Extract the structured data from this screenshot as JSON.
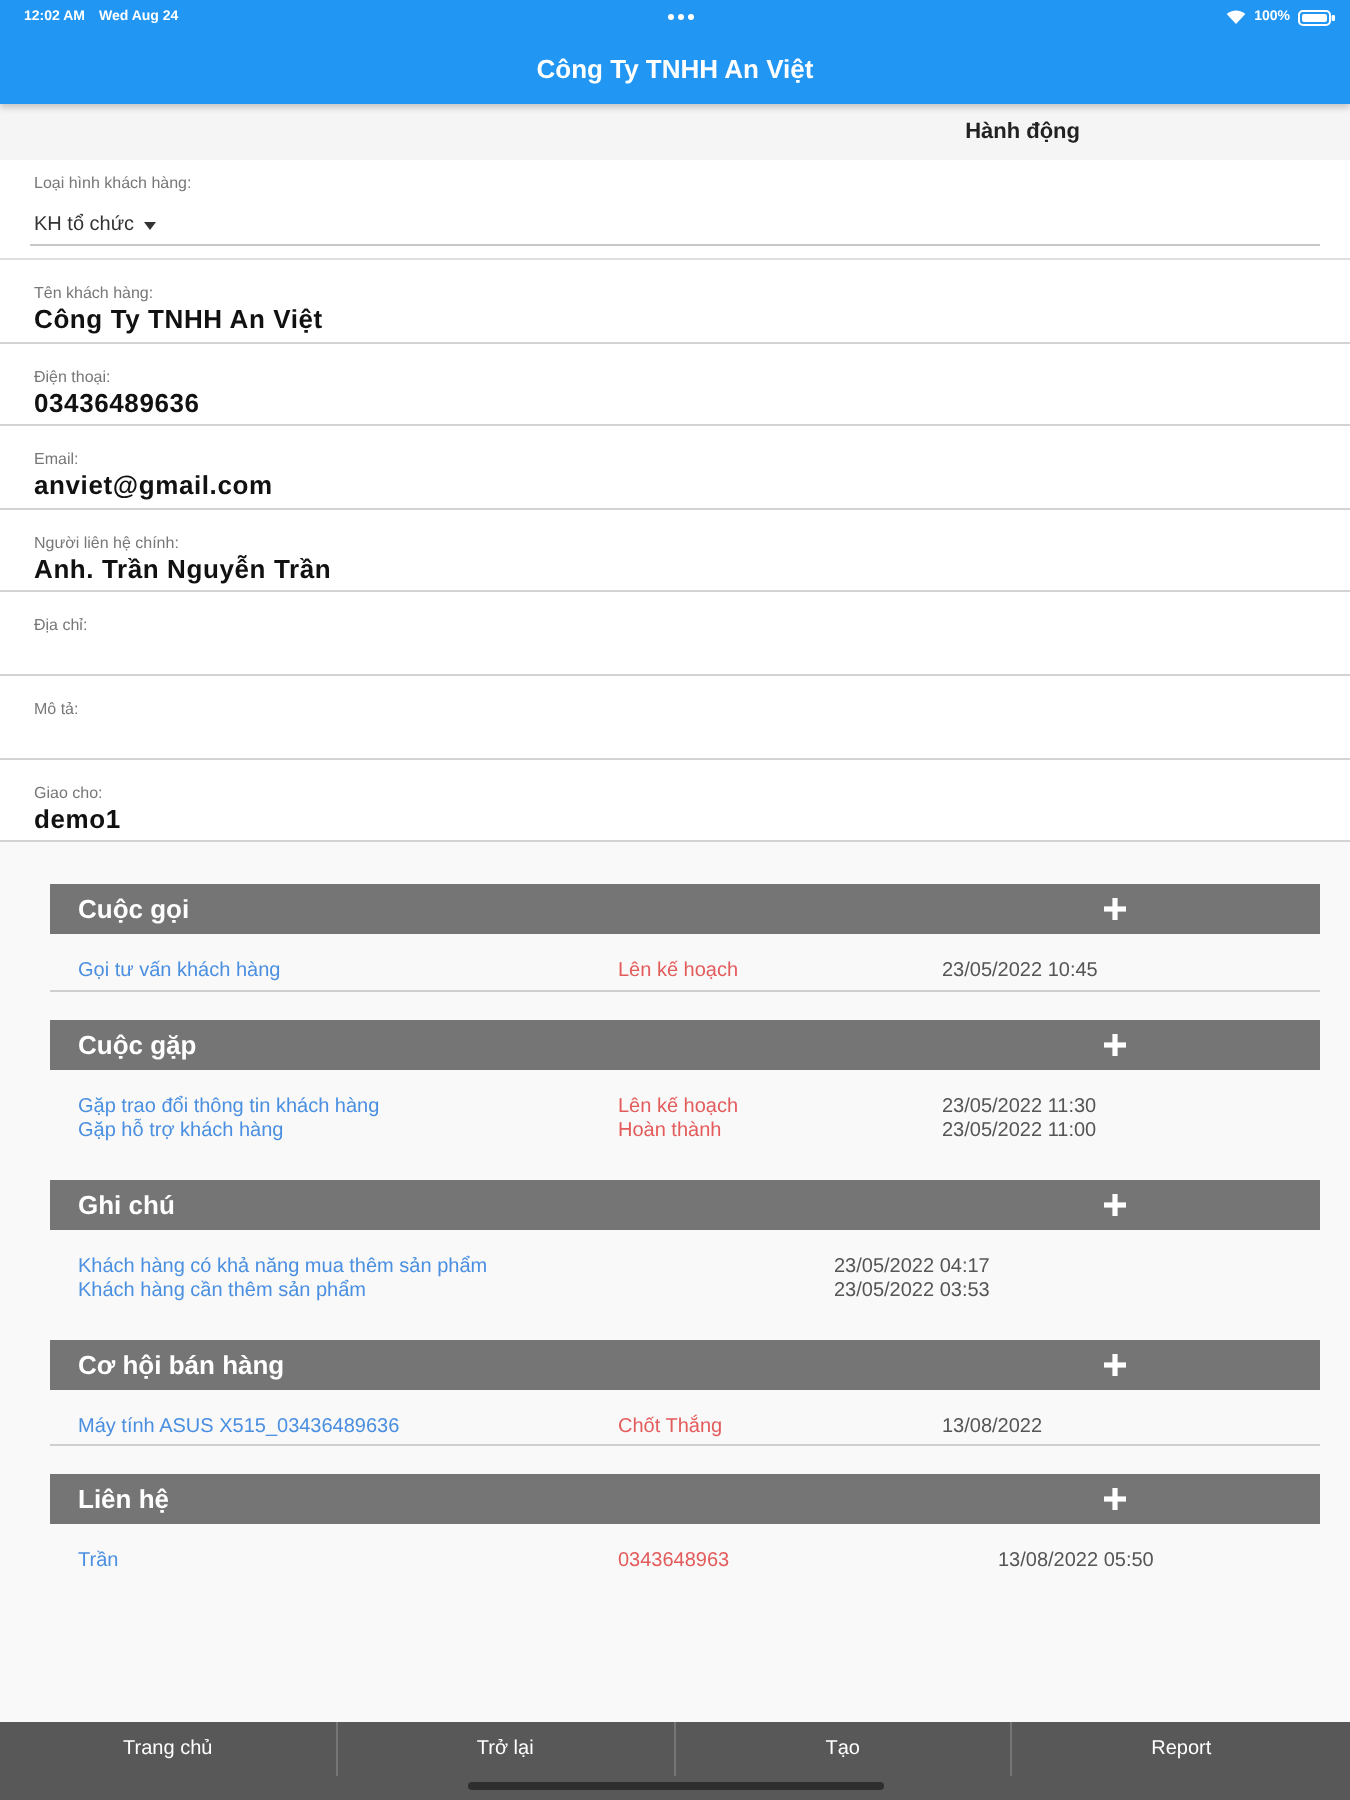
{
  "status_bar": {
    "time": "12:02 AM",
    "date": "Wed Aug 24",
    "battery": "100%"
  },
  "app_bar": {
    "title": "Công Ty TNHH An Việt"
  },
  "action_bar": {
    "label": "Hành động"
  },
  "form": {
    "fields": [
      {
        "kind": "dropdown",
        "label": "Loại hình khách hàng:",
        "value": "KH tổ chức"
      },
      {
        "kind": "text",
        "label": "Tên khách hàng:",
        "value": "Công Ty TNHH An Việt"
      },
      {
        "kind": "text",
        "label": "Điện thoại:",
        "value": "03436489636"
      },
      {
        "kind": "text",
        "label": "Email:",
        "value": "anviet@gmail.com"
      },
      {
        "kind": "text",
        "label": "Người liên hệ chính:",
        "value": "Anh. Trần Nguyễn Trần"
      },
      {
        "kind": "text",
        "label": "Địa chỉ:"
      },
      {
        "kind": "text",
        "label": "Mô tả:"
      },
      {
        "kind": "text",
        "label": "Giao cho:",
        "value": "demo1"
      }
    ]
  },
  "sections": [
    {
      "kind": "activity",
      "title": "Cuộc gọi",
      "underlined": true,
      "rows": [
        {
          "title": "Gọi tư vấn khách hàng",
          "status": "Lên kế hoạch",
          "date": "23/05/2022 10:45"
        }
      ]
    },
    {
      "kind": "activity",
      "title": "Cuộc gặp",
      "underlined": false,
      "rows": [
        {
          "title": "Gặp trao đổi thông tin khách hàng",
          "status": "Lên kế hoạch",
          "date": "23/05/2022 11:30"
        },
        {
          "title": "Gặp hỗ trợ khách hàng",
          "status": "Hoàn thành",
          "date": "23/05/2022 11:00"
        }
      ]
    },
    {
      "kind": "note",
      "title": "Ghi chú",
      "underlined": false,
      "rows": [
        {
          "title": "Khách hàng có khả năng mua thêm sản phẩm",
          "date": "23/05/2022 04:17"
        },
        {
          "title": "Khách hàng cần thêm sản phẩm",
          "date": "23/05/2022 03:53"
        }
      ]
    },
    {
      "kind": "activity",
      "title": "Cơ hội bán hàng",
      "underlined": true,
      "rows": [
        {
          "title": "Máy tính ASUS X515_03436489636",
          "status": "Chốt Thắng",
          "date": "13/08/2022"
        }
      ]
    },
    {
      "kind": "contact",
      "title": "Liên hệ",
      "underlined": false,
      "rows": [
        {
          "name": "Trần",
          "phone": "0343648963",
          "date": "13/08/2022 05:50"
        }
      ]
    }
  ],
  "bottom_bar": {
    "tabs": [
      {
        "label": "Trang chủ",
        "selected": false
      },
      {
        "label": "Trở lại",
        "selected": false
      },
      {
        "label": "Tạo",
        "selected": false
      },
      {
        "label": "Report",
        "selected": false
      }
    ]
  }
}
